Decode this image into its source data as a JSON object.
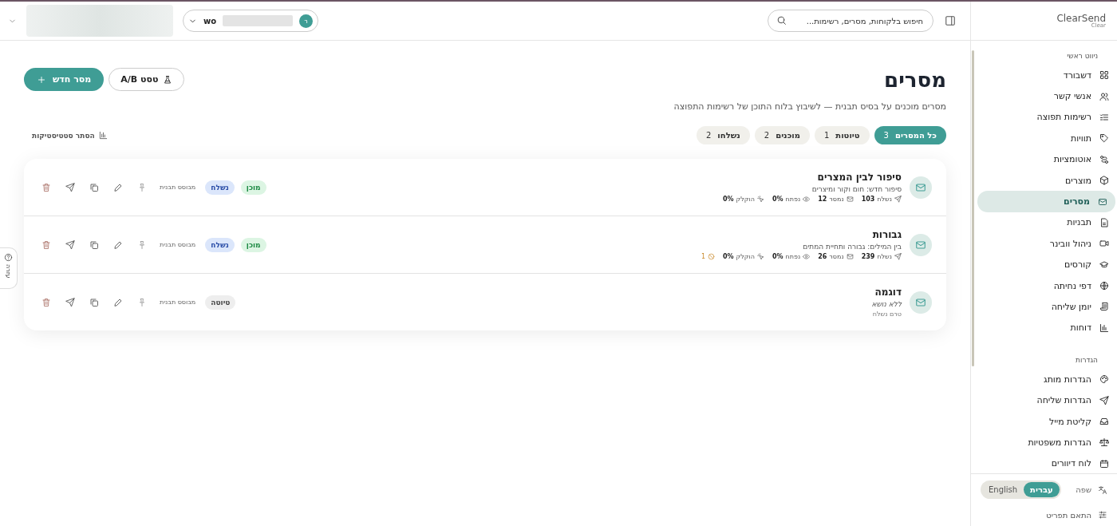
{
  "header": {
    "search": {
      "placeholder": "חיפוש בלקוחות, מסרים, רשימות..."
    },
    "account": {
      "avatar": "ר",
      "name": "wo"
    }
  },
  "sidebar": {
    "logo": {
      "name": "ClearSend",
      "sub": "Clear"
    },
    "sections": [
      {
        "title": "ניווט ראשי",
        "items": [
          {
            "label": "דשבורד",
            "selected": false
          },
          {
            "label": "אנשי קשר",
            "selected": false
          },
          {
            "label": "רשימות תפוצה",
            "selected": false
          },
          {
            "label": "תוויות",
            "selected": false
          },
          {
            "label": "אוטומציות",
            "selected": false
          },
          {
            "label": "מוצרים",
            "selected": false
          },
          {
            "label": "מסרים",
            "selected": true
          },
          {
            "label": "תבניות",
            "selected": false
          },
          {
            "label": "ניהול וובינר",
            "selected": false
          },
          {
            "label": "קורסים",
            "selected": false
          },
          {
            "label": "דפי נחיתה",
            "selected": false
          },
          {
            "label": "יומן שליחה",
            "selected": false
          },
          {
            "label": "דוחות",
            "selected": false
          }
        ]
      },
      {
        "title": "הגדרות",
        "items": [
          {
            "label": "הגדרות מותג",
            "selected": false
          },
          {
            "label": "הגדרות שליחה",
            "selected": false
          },
          {
            "label": "קליטת מייל",
            "selected": false
          },
          {
            "label": "הגדרות משפטיות",
            "selected": false
          },
          {
            "label": "לוח דיוורים",
            "selected": false
          }
        ]
      }
    ],
    "language": {
      "label": "שפה",
      "options": [
        {
          "label": "עברית",
          "selected": true
        },
        {
          "label": "English",
          "selected": false
        }
      ]
    },
    "customize": "התאם תפריט"
  },
  "page": {
    "title": "מסרים",
    "subtitle": "מסרים מוכנים על בסיס תבנית — לשיבוץ בלוח התוכן של רשימות התפוצה",
    "new_button": "מסר חדש",
    "ab_button": "טסט A/B",
    "filters": [
      {
        "label": "כל המסרים",
        "count": "3",
        "selected": true
      },
      {
        "label": "טיוטות",
        "count": "1",
        "selected": false
      },
      {
        "label": "מוכנים",
        "count": "2",
        "selected": false
      },
      {
        "label": "נשלחו",
        "count": "2",
        "selected": false
      }
    ],
    "stats_toggle": "הסתר סטטיסטיקות"
  },
  "messages": [
    {
      "kind": "sent",
      "title": "סיפור לבין המצרים",
      "subject": "סיפור חדש: חום וקור ומיצרים",
      "stats": [
        {
          "kind": "sent",
          "label": "נשלח",
          "value": "103"
        },
        {
          "kind": "delivered",
          "label": "נמסר",
          "value": "12"
        },
        {
          "kind": "opened",
          "label": "נפתח",
          "value": "0%"
        },
        {
          "kind": "clicked",
          "label": "הוקלק",
          "value": "0%"
        }
      ],
      "badges": [
        {
          "kind": "ready",
          "label": "מוכן"
        },
        {
          "kind": "sent",
          "label": "נשלח"
        }
      ],
      "template": "מבוסס תבנית"
    },
    {
      "kind": "sent",
      "title": "גבורות",
      "subject": "בין המילים: גבורה ותחיית המתים",
      "stats": [
        {
          "kind": "sent",
          "label": "נשלח",
          "value": "239"
        },
        {
          "kind": "delivered",
          "label": "נמסר",
          "value": "26"
        },
        {
          "kind": "opened",
          "label": "נפתח",
          "value": "0%"
        },
        {
          "kind": "clicked",
          "label": "הוקלק",
          "value": "0%"
        },
        {
          "kind": "blocked",
          "value": "1"
        }
      ],
      "badges": [
        {
          "kind": "ready",
          "label": "מוכן"
        },
        {
          "kind": "sent",
          "label": "נשלח"
        }
      ],
      "template": "מבוסס תבנית"
    },
    {
      "kind": "draft",
      "title": "דוגמה",
      "subject": "ללא נושא",
      "note": "טרם נשלח",
      "badges": [
        {
          "kind": "draft",
          "label": "טיוטה"
        }
      ],
      "template": "מבוסס תבנית"
    }
  ],
  "help_tab": "עזרה"
}
